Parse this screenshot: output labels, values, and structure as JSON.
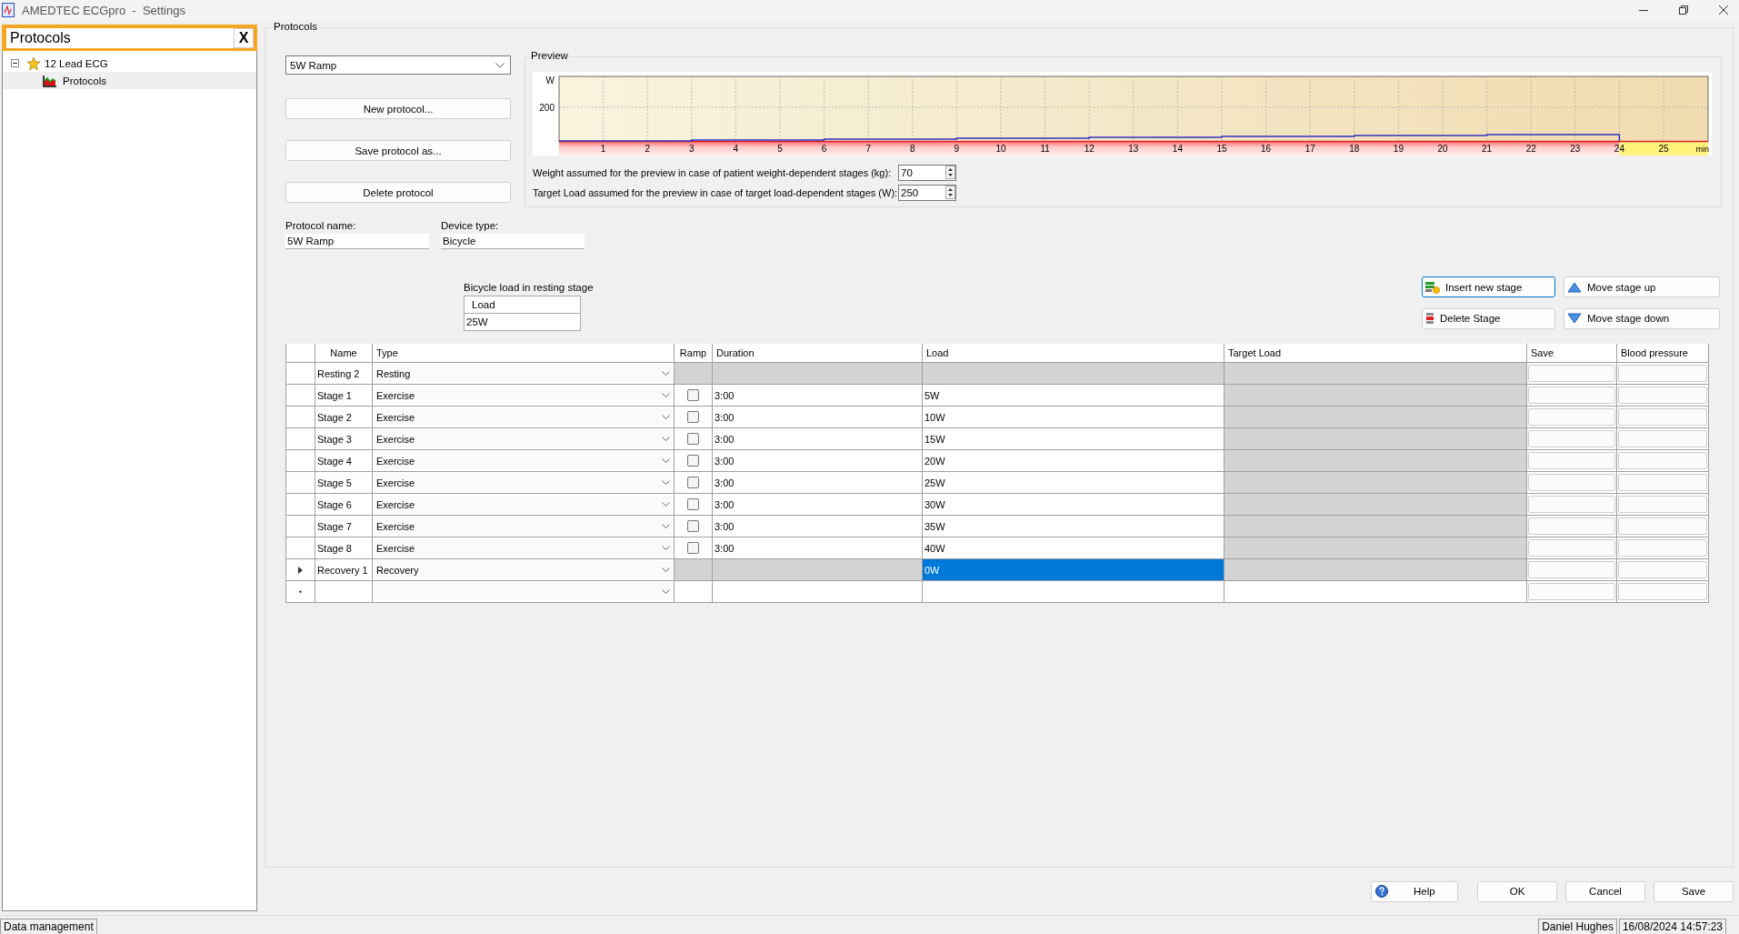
{
  "window": {
    "title": "AMEDTEC ECGpro  -  Settings"
  },
  "sidebar": {
    "search": {
      "value": "Protocols",
      "clear": "X"
    },
    "tree": [
      {
        "label": "12 Lead ECG",
        "kind": "star",
        "expanded": true,
        "selected": false,
        "children": [
          {
            "label": "Protocols",
            "kind": "chart",
            "selected": true
          }
        ]
      }
    ]
  },
  "group_title": "Protocols",
  "protocol_select": {
    "value": "5W Ramp"
  },
  "protocol_buttons": [
    "New protocol...",
    "Save protocol as...",
    "Delete protocol"
  ],
  "protocol_name": {
    "label": "Protocol name:",
    "value": "5W Ramp"
  },
  "device_type": {
    "label": "Device type:",
    "value": "Bicycle"
  },
  "preview": {
    "title": "Preview",
    "y_unit": "W",
    "y_tick": "200",
    "x_unit": "min",
    "x_ticks": [
      "1",
      "2",
      "3",
      "4",
      "5",
      "6",
      "7",
      "8",
      "9",
      "10",
      "11",
      "12",
      "13",
      "14",
      "15",
      "16",
      "17",
      "18",
      "19",
      "20",
      "21",
      "22",
      "23",
      "24",
      "25"
    ],
    "settings": [
      {
        "label": "Weight assumed for the preview in case of patient weight-dependent stages (kg):",
        "value": "70"
      },
      {
        "label": "Target Load assumed for the preview in case of target load-dependent stages (W):",
        "value": "250"
      }
    ]
  },
  "resting_load": {
    "label": "Bicycle load in resting stage",
    "column": "Load",
    "value": "25W"
  },
  "stage_buttons": [
    {
      "label": "Insert new stage",
      "kind": "insert",
      "focused": true
    },
    {
      "label": "Move stage up",
      "kind": "up",
      "focused": false
    },
    {
      "label": "Delete Stage",
      "kind": "delete",
      "focused": false
    },
    {
      "label": "Move stage down",
      "kind": "down",
      "focused": false
    }
  ],
  "table": {
    "columns": [
      "Name",
      "Type",
      "Ramp",
      "Duration",
      "Load",
      "Target Load",
      "Save",
      "Blood pressure"
    ],
    "rows": [
      {
        "kind": "resting",
        "name": "Resting 2",
        "type": "Resting",
        "selected": false
      },
      {
        "kind": "exercise",
        "name": "Stage 1",
        "type": "Exercise",
        "ramp": false,
        "duration": "3:00",
        "load": "5W",
        "selected": false
      },
      {
        "kind": "exercise",
        "name": "Stage 2",
        "type": "Exercise",
        "ramp": false,
        "duration": "3:00",
        "load": "10W",
        "selected": false
      },
      {
        "kind": "exercise",
        "name": "Stage 3",
        "type": "Exercise",
        "ramp": false,
        "duration": "3:00",
        "load": "15W",
        "selected": false
      },
      {
        "kind": "exercise",
        "name": "Stage 4",
        "type": "Exercise",
        "ramp": false,
        "duration": "3:00",
        "load": "20W",
        "selected": false
      },
      {
        "kind": "exercise",
        "name": "Stage 5",
        "type": "Exercise",
        "ramp": false,
        "duration": "3:00",
        "load": "25W",
        "selected": false
      },
      {
        "kind": "exercise",
        "name": "Stage 6",
        "type": "Exercise",
        "ramp": false,
        "duration": "3:00",
        "load": "30W",
        "selected": false
      },
      {
        "kind": "exercise",
        "name": "Stage 7",
        "type": "Exercise",
        "ramp": false,
        "duration": "3:00",
        "load": "35W",
        "selected": false
      },
      {
        "kind": "exercise",
        "name": "Stage 8",
        "type": "Exercise",
        "ramp": false,
        "duration": "3:00",
        "load": "40W",
        "selected": false
      },
      {
        "kind": "recovery",
        "name": "Recovery 1",
        "type": "Recovery",
        "load": "0W",
        "selected": true
      },
      {
        "kind": "new",
        "marker": "*",
        "selected": false
      }
    ]
  },
  "dialog_buttons": [
    {
      "label": "Help",
      "kind": "help"
    },
    {
      "label": "OK",
      "kind": "plain"
    },
    {
      "label": "Cancel",
      "kind": "plain"
    },
    {
      "label": "Save",
      "kind": "plain"
    }
  ],
  "status_bar": {
    "left": "Data management",
    "user": "Daniel Hughes",
    "datetime": "16/08/2024 14:57:23"
  }
}
